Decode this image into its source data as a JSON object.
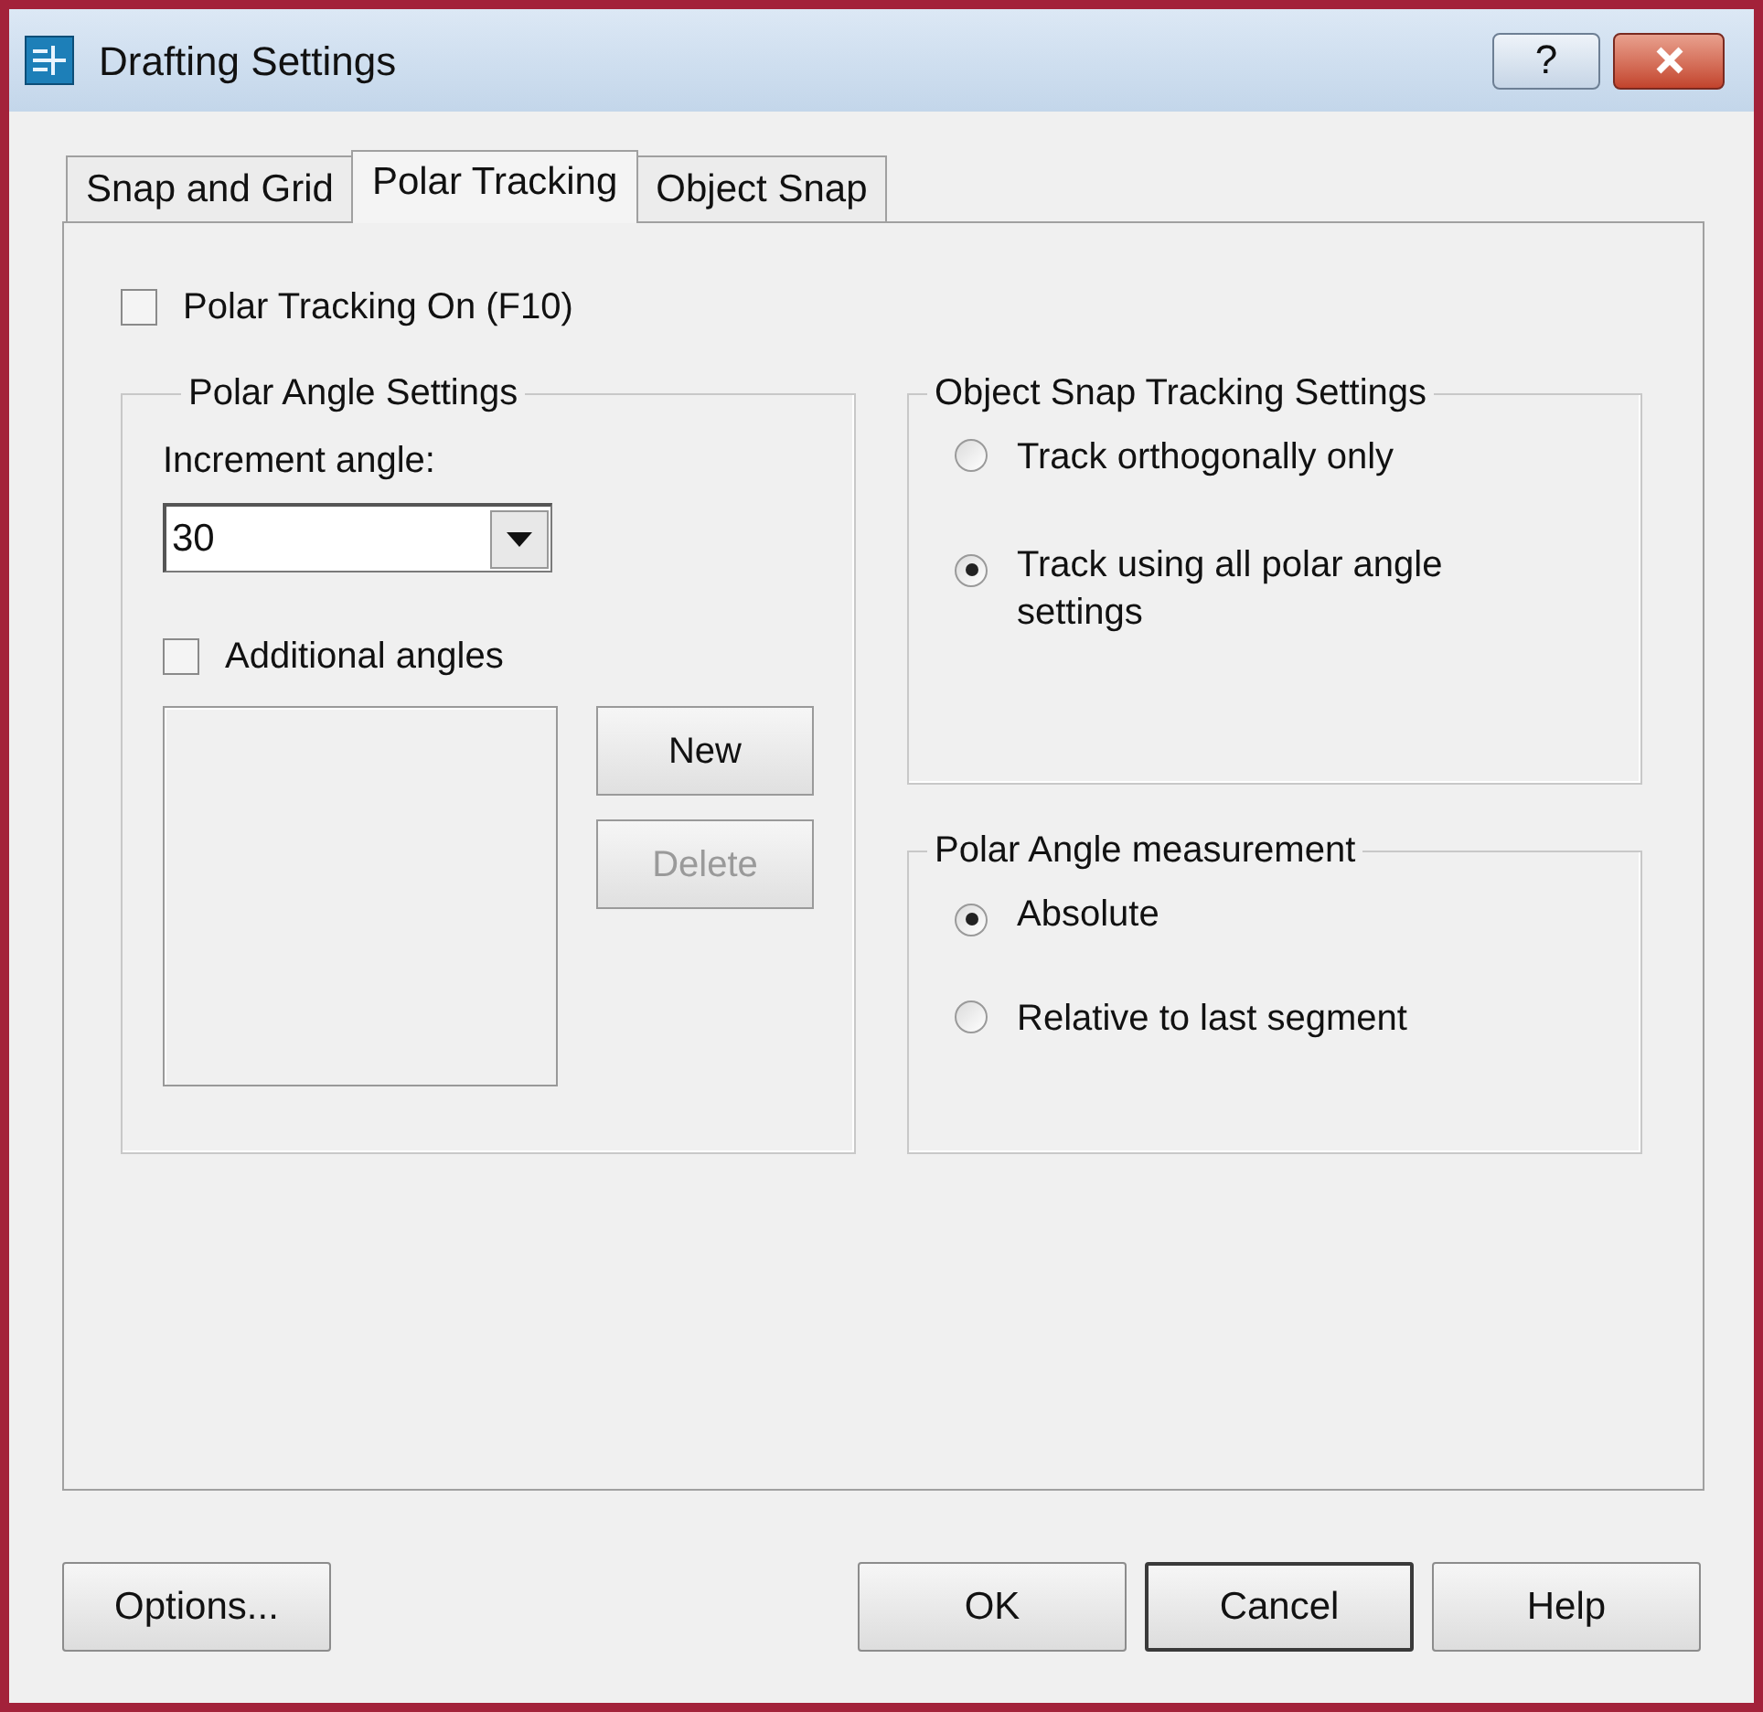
{
  "window": {
    "title": "Drafting Settings",
    "help_button": "?"
  },
  "tabs": [
    {
      "label": "Snap and Grid",
      "selected": false
    },
    {
      "label": "Polar Tracking",
      "selected": true
    },
    {
      "label": "Object Snap",
      "selected": false
    }
  ],
  "polar_tracking_on": {
    "label": "Polar Tracking On (F10)",
    "checked": false
  },
  "polar_angle_settings": {
    "title": "Polar Angle Settings",
    "increment_label": "Increment angle:",
    "increment_value": "30",
    "additional_angles": {
      "label": "Additional angles",
      "checked": false
    },
    "buttons": [
      {
        "label": "New",
        "disabled": false
      },
      {
        "label": "Delete",
        "disabled": true
      }
    ]
  },
  "object_snap_tracking": {
    "title": "Object Snap Tracking Settings",
    "options": [
      {
        "label": "Track orthogonally only",
        "selected": false
      },
      {
        "label": "Track using all polar angle settings",
        "selected": true
      }
    ]
  },
  "polar_angle_measurement": {
    "title": "Polar Angle measurement",
    "options": [
      {
        "label": "Absolute",
        "selected": true
      },
      {
        "label": "Relative to last segment",
        "selected": false
      }
    ]
  },
  "left_buttons": [
    {
      "label": "Options...",
      "focused": false
    }
  ],
  "right_buttons": [
    {
      "label": "OK",
      "focused": false
    },
    {
      "label": "Cancel",
      "focused": true
    },
    {
      "label": "Help",
      "focused": false
    }
  ]
}
